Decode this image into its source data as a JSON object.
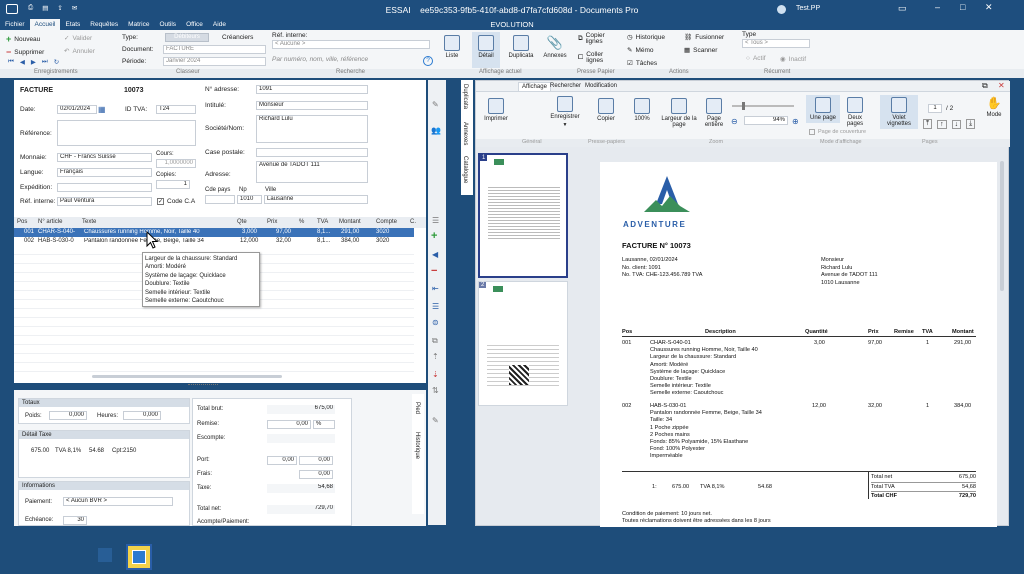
{
  "window": {
    "app_name": "ESSAI",
    "doc_title": "ee59c353-9fb5-410f-abd8-d7fa7cfd608d - Documents Pro",
    "subtitle": "EVOLUTION",
    "user": "Test.PP"
  },
  "menu": [
    "Fichier",
    "Accueil",
    "Etats",
    "Requêtes",
    "Matrice",
    "Outils",
    "Office",
    "Aide"
  ],
  "ribbon": {
    "nouveau": "Nouveau",
    "valider": "Valider",
    "supprimer": "Supprimer",
    "annuler": "Annuler",
    "type_label": "Type:",
    "type_debiteurs": "Débiteurs",
    "type_crediteurs": "Créanciers",
    "document_label": "Document:",
    "document_value": "FACTURE",
    "periode_label": "Période:",
    "periode_value": "Janvier 2024",
    "ref_interne_label": "Réf. interne:",
    "ref_interne_value": "< Aucune >",
    "search_placeholder": "Par numéro, nom, ville, référence",
    "liste": "Liste",
    "detail": "Détail",
    "duplicata": "Duplicata",
    "annexes": "Annexes",
    "copier_lignes": "Copier lignes",
    "coller_lignes": "Coller lignes",
    "historique": "Historique",
    "memo": "Mémo",
    "taches": "Tâches",
    "fusionner": "Fusionner",
    "scanner": "Scanner",
    "type2_label": "Type",
    "type2_value": "< Tous >",
    "actif": "Actif",
    "inactif": "Inactif",
    "groups": [
      "Enregistrements",
      "Classeur",
      "Recherche",
      "Affichage actuel",
      "Presse Papier",
      "Actions",
      "Récurrent"
    ]
  },
  "form": {
    "doc_type": "FACTURE",
    "doc_number": "10073",
    "date_label": "Date:",
    "date_value": "02/01/2024",
    "idtva_label": "ID TVA:",
    "idtva_value": "T24",
    "reference_label": "Référence:",
    "monnaie_label": "Monnaie:",
    "monnaie_value": "CHF - Francs Suisse",
    "cours_label": "Cours:",
    "cours_value": "1,0000000",
    "langue_label": "Langue:",
    "langue_value": "Français",
    "copies_label": "Copies:",
    "copies_value": "1",
    "expedition_label": "Expédition:",
    "refint_label": "Réf. interne:",
    "refint_value": "Paul Ventura",
    "codeca_label": "Code C.A",
    "adresse_no_label": "N° adresse:",
    "adresse_no_value": "1091",
    "intitule_label": "Intitulé:",
    "intitule_value": "Monsieur",
    "societe_label": "Société/Nom:",
    "societe_value": "Richard Lulu",
    "case_label": "Case postale:",
    "adresse_label": "Adresse:",
    "adresse_value": "Avenue de TADOT 111",
    "cdepays_label": "Cde pays",
    "np_label": "Np",
    "ville_label": "Ville",
    "np_value": "1010",
    "ville_value": "Lausanne"
  },
  "lines": {
    "headers": [
      "Pos",
      "N° article",
      "Texte",
      "Qte",
      "Prix",
      "%",
      "TVA",
      "Montant",
      "Compte",
      "C."
    ],
    "rows": [
      {
        "pos": "001",
        "article": "CHAR-S-040-",
        "texte": "Chaussures running Homme, Noir, Taille 40",
        "qte": "3,000",
        "prix": "97,00",
        "pct": "",
        "tva": "8,1...",
        "montant": "291,00",
        "compte": "3020"
      },
      {
        "pos": "002",
        "article": "HAB-S-030-0",
        "texte": "Pantalon randonnée Femme, Beige, Taille 34",
        "qte": "12,000",
        "prix": "32,00",
        "pct": "",
        "tva": "8,1...",
        "montant": "384,00",
        "compte": "3020"
      }
    ],
    "tooltip": [
      "Largeur de la chaussure: Standard",
      "Amorti: Modéré",
      "Système de laçage: Quicklace",
      "Doublure: Textile",
      "Semelle intérieur: Textile",
      "Semelle externe: Caoutchouc"
    ]
  },
  "totals": {
    "totaux_label": "Totaux",
    "poids_label": "Poids:",
    "poids_value": "0,000",
    "heures_label": "Heures:",
    "heures_value": "0,000",
    "detail_taxe_label": "Détail Taxe",
    "detail_taxe_row": [
      "675.00",
      "TVA 8,1%",
      "54.68",
      "Cpt:2150"
    ],
    "informations_label": "Informations",
    "paiement_label": "Paiement:",
    "paiement_value": "< Aucun BVR >",
    "echeance_label": "Echéance:",
    "echeance_value": "30",
    "total_brut_label": "Total brut:",
    "total_brut_value": "675,00",
    "remise_label": "Remise:",
    "remise_value": "0,00",
    "remise_unit": "%",
    "escompte_label": "Escompte:",
    "port_label": "Port:",
    "port_value1": "0,00",
    "port_value2": "0,00",
    "frais_label": "Frais:",
    "frais_value": "0,00",
    "taxe_label": "Taxe:",
    "taxe_value": "54,68",
    "total_net_label": "Total net:",
    "total_net_value": "729,70",
    "acompte_label": "Acompte/Paiement:",
    "side_tabs": [
      "Pied",
      "Historique"
    ]
  },
  "vertical_tabs": [
    "Duplicata",
    "Annexes",
    "Catalogue"
  ],
  "preview": {
    "tabs": [
      "Affichage",
      "Rechercher",
      "Modification"
    ],
    "imprimer": "Imprimer",
    "enregistrer": "Enregistrer",
    "copier": "Copier",
    "pct100": "100%",
    "largeur_page": "Largeur de la page",
    "page_entiere": "Page entière",
    "zoom_value": "94%",
    "une_page": "Une page",
    "deux_pages": "Deux pages",
    "page_couverture": "Page de couverture",
    "volet_vignettes": "Volet vignettes",
    "page_current": "1",
    "page_total": "/ 2",
    "mode": "Mode",
    "groups": [
      "Général",
      "Presse-papiers",
      "Zoom",
      "Mode d'affichage",
      "Pages"
    ],
    "thumb_numbers": [
      "1",
      "2"
    ]
  },
  "invoice": {
    "brand": "ADVENTURE",
    "title": "FACTURE N° 10073",
    "meta": [
      "Lausanne,  02/01/2024",
      "No. client: 1091",
      "No. TVA: CHE-123.456.789 TVA"
    ],
    "recipient": [
      "Monsieur",
      "Richard Lulu",
      "Avenue de TADOT 111",
      "1010 Lausanne"
    ],
    "headers": [
      "Pos",
      "Description",
      "Quantité",
      "Prix",
      "Remise",
      "TVA",
      "Montant"
    ],
    "items": [
      {
        "pos": "001",
        "lines": [
          "CHAR-S-040-01",
          "Chaussures running Homme, Noir, Taille 40",
          "Largeur de la chaussure: Standard",
          "Amorti: Modéré",
          "Système de laçage: Quicklace",
          "Doublure: Textile",
          "Semelle intérieur: Textile",
          "Semelle externe: Caoutchouc"
        ],
        "qte": "3,00",
        "prix": "97,00",
        "tva": "1",
        "montant": "291,00"
      },
      {
        "pos": "002",
        "lines": [
          "HAB-S-030-01",
          "Pantalon randonnée Femme, Beige, Taille 34",
          "Taille: 34",
          "1 Poche zippée",
          "2 Poches mains",
          "Fonds: 85% Polyamide, 15% Elasthane",
          "Fond: 100% Polyester",
          "Imperméable"
        ],
        "qte": "12,00",
        "prix": "32,00",
        "tva": "1",
        "montant": "384,00"
      }
    ],
    "tax_row": [
      "1:",
      "675.00",
      "TVA 8,1%",
      "54.68"
    ],
    "totals": [
      {
        "label": "Total net",
        "value": "675,00"
      },
      {
        "label": "Total TVA",
        "value": "54,68"
      },
      {
        "label": "Total CHF",
        "value": "729,70"
      }
    ],
    "footer": [
      "Condition de paiement: 10 jours net.",
      "Toutes réclamations doivent être adressées dans les 8 jours"
    ]
  },
  "colors": {
    "titlebar": "#1e4e7e",
    "selection": "#3a72b8",
    "accent_green": "#2e9b3a"
  }
}
